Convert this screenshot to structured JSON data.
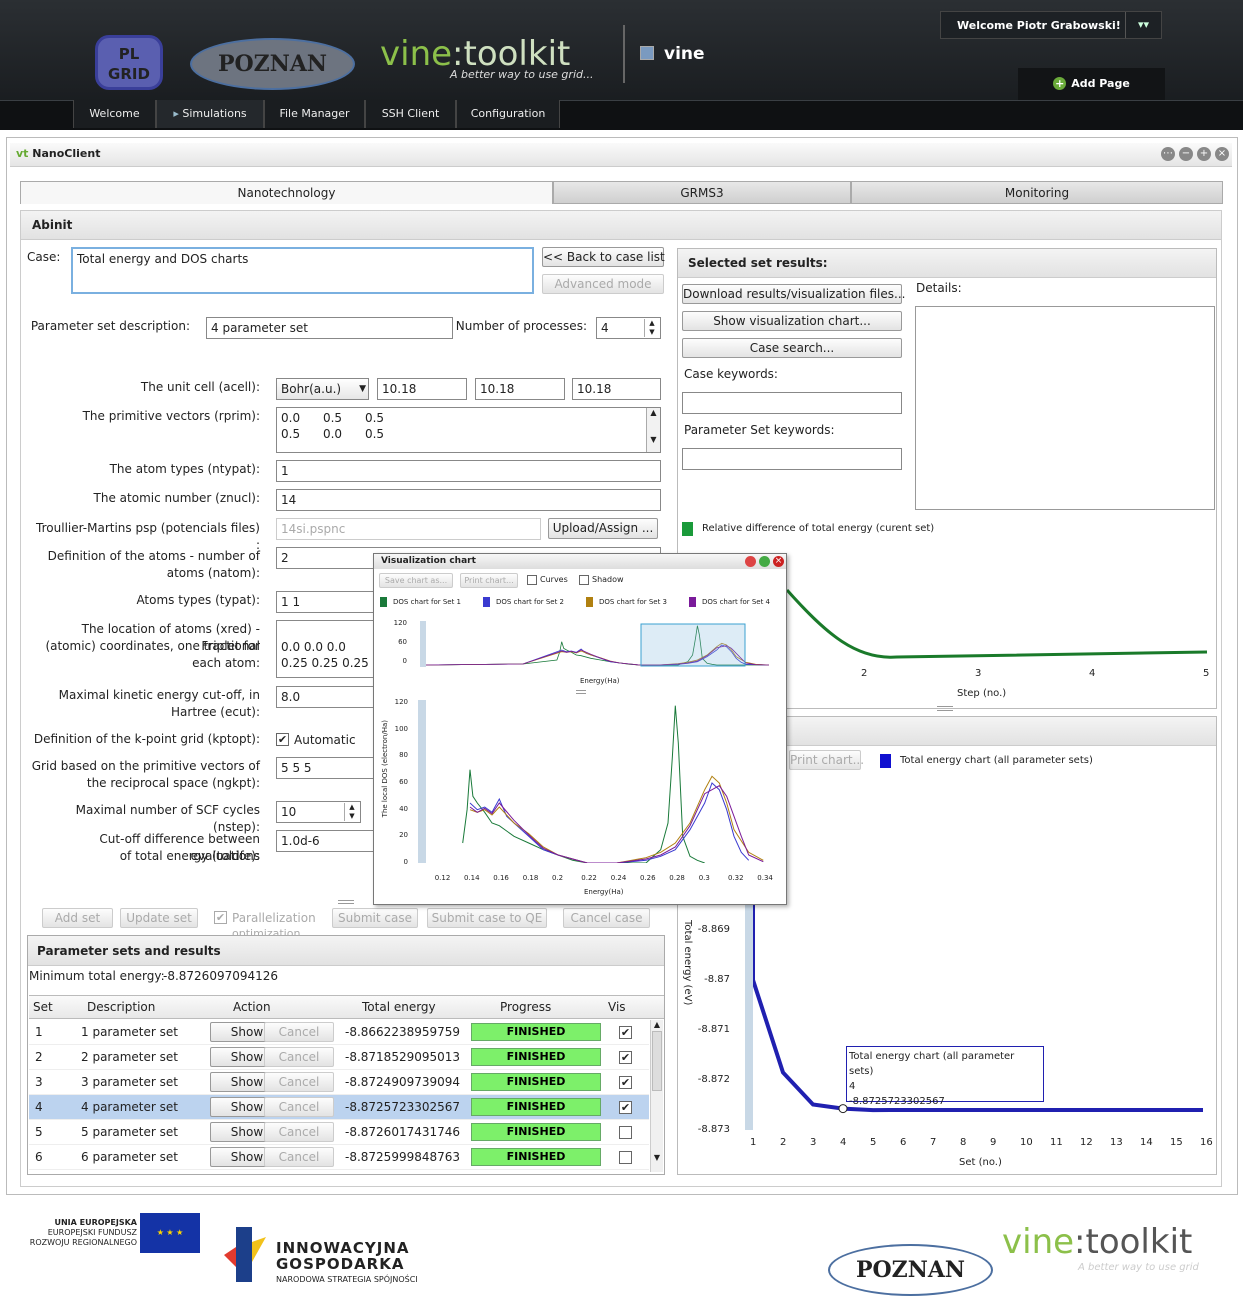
{
  "header": {
    "welcome": "Welcome Piotr Grabowski!",
    "plgrid_logo": "PL GRID",
    "poznan_logo": "POZNAN",
    "vine_logo_a": "vine",
    "vine_logo_b": ":toolkit",
    "vine_tagline": "A better way to use grid...",
    "app_name": "vine",
    "add_page": "Add Page",
    "nav": [
      "Welcome",
      "Simulations",
      "File Manager",
      "SSH Client",
      "Configuration"
    ]
  },
  "portlet": {
    "prefix": "vt",
    "title": "NanoClient",
    "tabs": [
      "Nanotechnology",
      "GRMS3",
      "Monitoring"
    ],
    "section": "Abinit"
  },
  "form": {
    "case_label": "Case:",
    "case_value": "Total energy and DOS charts",
    "back_button": "<< Back to case list",
    "advanced_button": "Advanced mode",
    "param_desc_label": "Parameter set description:",
    "param_desc_value": "4 parameter set",
    "nproc_label": "Number of processes:",
    "nproc_value": "4",
    "acell_label": "The unit cell (acell):",
    "acell_unit": "Bohr(a.u.)",
    "acell_values": [
      "10.18",
      "10.18",
      "10.18"
    ],
    "rprim_label": "The primitive vectors (rprim):",
    "rprim_line1": "0.0      0.5      0.5",
    "rprim_line2": "0.5      0.0      0.5",
    "ntypat_label": "The atom types (ntypat):",
    "ntypat_value": "1",
    "znucl_label": "The atomic number (znucl):",
    "znucl_value": "14",
    "psp_label": "Troullier-Martins psp (potencials files) :",
    "psp_value": "14si.pspnc",
    "upload_button": "Upload/Assign ...",
    "natom_label_1": "Definition of the atoms - number of",
    "natom_label_2": "atoms (natom):",
    "natom_value": "2",
    "typat_label": "Atoms types (typat):",
    "typat_value": "1 1",
    "xred_label_1": "The location of atoms (xred) - Fractional",
    "xred_label_2": "(atomic) coordinates, one triplet for",
    "xred_label_3": "each atom:",
    "xred_line1": "0.0 0.0 0.0",
    "xred_line2": "0.25 0.25 0.25",
    "ecut_label_1": "Maximal kinetic energy cut-off, in",
    "ecut_label_2": "Hartree (ecut):",
    "ecut_value": "8.0",
    "kptopt_label": "Definition of the k-point grid (kptopt):",
    "kptopt_check": "Automatic",
    "ngkpt_label_1": "Grid based on the primitive vectors of",
    "ngkpt_label_2": "the reciprocal space (ngkpt):",
    "ngkpt_value": "5 5 5",
    "nstep_label": "Maximal number of SCF cycles (nstep):",
    "nstep_value": "10",
    "toldfe_label_1": "Cut-off difference between evaluations",
    "toldfe_label_2": "of total energy (toldfe):",
    "toldfe_value": "1.0d-6",
    "buttons": {
      "add_set": "Add set",
      "update_set": "Update set",
      "parallel_1": "Parallelization",
      "parallel_2": "optimization",
      "submit_case": "Submit case",
      "submit_qe": "Submit case to QE",
      "cancel_case": "Cancel case"
    }
  },
  "results": {
    "title": "Parameter sets and results",
    "min_label": "Minimum total energy:",
    "min_value": "-8.87260970941​26",
    "columns": [
      "Set",
      "Description",
      "Action",
      "Total energy",
      "Progress",
      "Vis"
    ],
    "show": "Show",
    "cancel": "Cancel",
    "rows": [
      {
        "set": "1",
        "desc": "1 parameter set",
        "energy": "-8.8662238959759",
        "progress": "FINISHED",
        "vis": "✔"
      },
      {
        "set": "2",
        "desc": "2 parameter set",
        "energy": "-8.8718529095013",
        "progress": "FINISHED",
        "vis": "✔"
      },
      {
        "set": "3",
        "desc": "3 parameter set",
        "energy": "-8.87249097390​94",
        "progress": "FINISHED",
        "vis": "✔"
      },
      {
        "set": "4",
        "desc": "4 parameter set",
        "energy": "-8.8725723302567",
        "progress": "FINISHED",
        "vis": "✔"
      },
      {
        "set": "5",
        "desc": "5 parameter set",
        "energy": "-8.8726017431746",
        "progress": "FINISHED",
        "vis": ""
      },
      {
        "set": "6",
        "desc": "6 parameter set",
        "energy": "-8.8725999848763",
        "progress": "FINISHED",
        "vis": ""
      }
    ]
  },
  "right": {
    "title": "Selected set results:",
    "download": "Download results/visualization files...",
    "show_chart": "Show visualization chart...",
    "case_search": "Case search...",
    "case_keywords": "Case keywords:",
    "param_keywords": "Parameter Set keywords:",
    "details": "Details:",
    "rel_legend": "Relative difference of total energy (curent set)",
    "step_xlabel": "Step (no.)",
    "step_ticks": [
      "2",
      "3",
      "4",
      "5"
    ],
    "print_chart": "Print chart...",
    "total_legend": "Total energy chart (all parameter sets)",
    "total_ylabel": "Total energy (eV)",
    "total_xlabel": "Set (no.)",
    "total_yticks": [
      "-8.869",
      "-8.87",
      "-8.871",
      "-8.872",
      "-8.873"
    ],
    "total_xticks": [
      "1",
      "2",
      "3",
      "4",
      "5",
      "6",
      "7",
      "8",
      "9",
      "10",
      "11",
      "12",
      "13",
      "14",
      "15",
      "16"
    ],
    "tooltip_l1": "Total energy chart (all parameter sets)",
    "tooltip_l2": "4",
    "tooltip_l3": "-8.8725723302567"
  },
  "popup": {
    "title": "Visualization chart",
    "save": "Save chart as...",
    "print": "Print chart...",
    "curves": "Curves",
    "shadow": "Shadow",
    "legend": [
      "DOS chart for Set 1",
      "DOS chart for Set 2",
      "DOS chart for Set 3",
      "DOS chart for Set 4"
    ],
    "colors": [
      "#1a7a3a",
      "#3a3ad0",
      "#b08010",
      "#7a1a9a"
    ],
    "mini_yticks": [
      "120",
      "60",
      "0"
    ],
    "mini_xlabel": "Energy(Ha)",
    "main_ylabel": "The local DOS (electron/Ha)",
    "main_xlabel": "Energy(Ha)",
    "main_yticks": [
      "120",
      "100",
      "80",
      "60",
      "40",
      "20",
      "0"
    ],
    "main_xticks": [
      "0.12",
      "0.14",
      "0.16",
      "0.18",
      "0.2",
      "0.22",
      "0.24",
      "0.26",
      "0.28",
      "0.3",
      "0.32",
      "0.34"
    ]
  },
  "chart_data": [
    {
      "type": "line",
      "title": "",
      "xlabel": "Energy(Ha)",
      "ylabel": "The local DOS (electron/Ha)",
      "xlim": [
        0.11,
        0.35
      ],
      "ylim": [
        0,
        120
      ],
      "series": [
        {
          "name": "DOS chart for Set 1",
          "x": [
            0.135,
            0.138,
            0.14,
            0.142,
            0.145,
            0.15,
            0.155,
            0.16,
            0.17,
            0.18,
            0.19,
            0.2,
            0.21,
            0.22,
            0.24,
            0.26,
            0.265,
            0.27,
            0.275,
            0.278,
            0.28,
            0.282,
            0.285,
            0.29,
            0.295,
            0.3
          ],
          "y": [
            15,
            40,
            70,
            50,
            45,
            38,
            30,
            28,
            20,
            15,
            10,
            6,
            2,
            0,
            0,
            0,
            5,
            10,
            30,
            80,
            118,
            90,
            20,
            5,
            2,
            0
          ]
        },
        {
          "name": "DOS chart for Set 2",
          "x": [
            0.14,
            0.145,
            0.15,
            0.155,
            0.16,
            0.165,
            0.17,
            0.18,
            0.19,
            0.2,
            0.22,
            0.24,
            0.26,
            0.27,
            0.28,
            0.29,
            0.3,
            0.305,
            0.31,
            0.315,
            0.32,
            0.325,
            0.33
          ],
          "y": [
            45,
            40,
            42,
            38,
            48,
            35,
            30,
            20,
            10,
            6,
            0,
            0,
            2,
            5,
            10,
            25,
            45,
            60,
            55,
            40,
            20,
            8,
            2
          ]
        },
        {
          "name": "DOS chart for Set 3",
          "x": [
            0.14,
            0.145,
            0.15,
            0.155,
            0.16,
            0.17,
            0.18,
            0.19,
            0.2,
            0.22,
            0.24,
            0.26,
            0.27,
            0.28,
            0.29,
            0.3,
            0.305,
            0.31,
            0.315,
            0.32,
            0.33,
            0.34
          ],
          "y": [
            40,
            38,
            40,
            36,
            42,
            30,
            22,
            12,
            6,
            0,
            0,
            4,
            8,
            15,
            30,
            55,
            65,
            60,
            45,
            25,
            8,
            2
          ]
        },
        {
          "name": "DOS chart for Set 4",
          "x": [
            0.14,
            0.145,
            0.15,
            0.155,
            0.16,
            0.17,
            0.18,
            0.19,
            0.2,
            0.22,
            0.24,
            0.26,
            0.27,
            0.28,
            0.29,
            0.3,
            0.31,
            0.315,
            0.32,
            0.325,
            0.33,
            0.34
          ],
          "y": [
            42,
            38,
            41,
            37,
            45,
            32,
            21,
            11,
            6,
            0,
            0,
            3,
            6,
            12,
            28,
            52,
            58,
            50,
            35,
            20,
            6,
            1
          ]
        }
      ]
    },
    {
      "type": "line",
      "title": "",
      "xlabel": "Set (no.)",
      "ylabel": "Total energy (eV)",
      "xlim": [
        0,
        16
      ],
      "ylim": [
        -8.873,
        -8.8685
      ],
      "series": [
        {
          "name": "Total energy chart (all parameter sets)",
          "x": [
            0,
            1,
            2,
            3,
            4,
            5,
            6,
            7,
            8,
            9,
            10,
            11,
            12,
            13,
            14,
            15,
            16
          ],
          "y": [
            -8.8662,
            -8.87,
            -8.87185,
            -8.87249,
            -8.872572,
            -8.872601,
            -8.8726,
            -8.8726,
            -8.8726,
            -8.8726,
            -8.8726,
            -8.8726,
            -8.8726,
            -8.8726,
            -8.8726,
            -8.8726,
            -8.8726
          ]
        }
      ]
    }
  ]
}
